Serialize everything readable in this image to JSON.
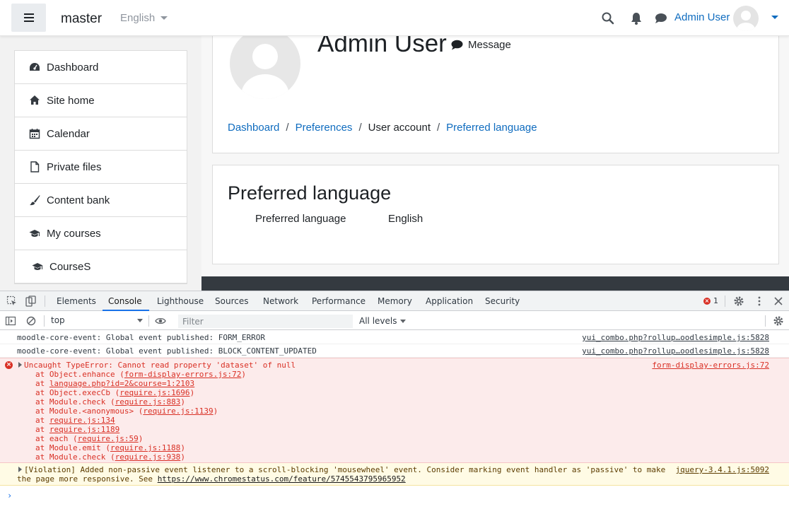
{
  "navbar": {
    "site_name": "master",
    "language": "English",
    "user_name": "Admin User"
  },
  "drawer": {
    "items": [
      {
        "label": "Dashboard",
        "icon": "dashboard-icon"
      },
      {
        "label": "Site home",
        "icon": "home-icon"
      },
      {
        "label": "Calendar",
        "icon": "calendar-icon"
      },
      {
        "label": "Private files",
        "icon": "file-icon"
      },
      {
        "label": "Content bank",
        "icon": "paintbrush-icon"
      },
      {
        "label": "My courses",
        "icon": "graduation-cap-icon"
      },
      {
        "label": "CourseS",
        "icon": "graduation-cap-icon"
      }
    ]
  },
  "profile": {
    "name": "Admin User",
    "message_label": "Message"
  },
  "breadcrumb": {
    "items": [
      "Dashboard",
      "Preferences",
      "User account",
      "Preferred language"
    ],
    "separator": "/"
  },
  "language_card": {
    "title": "Preferred language",
    "label": "Preferred language",
    "value": "English"
  },
  "devtools": {
    "tabs": [
      "Elements",
      "Console",
      "Lighthouse",
      "Sources",
      "Network",
      "Performance",
      "Memory",
      "Application",
      "Security"
    ],
    "active_tab": "Console",
    "error_count": "1",
    "context": "top",
    "filter_placeholder": "Filter",
    "levels": "All levels",
    "logs": [
      {
        "message": "moodle-core-event: Global event published: FORM_ERROR",
        "source": "yui_combo.php?rollup…oodlesimple.js:5828"
      },
      {
        "message": "moodle-core-event: Global event published: BLOCK_CONTENT_UPDATED",
        "source": "yui_combo.php?rollup…oodlesimple.js:5828"
      }
    ],
    "error": {
      "message": "Uncaught TypeError: Cannot read property 'dataset' of null",
      "source": "form-display-errors.js:72",
      "stack": [
        {
          "prefix": "at Object.enhance (",
          "link": "form-display-errors.js:72",
          "suffix": ")"
        },
        {
          "prefix": "at ",
          "link": "language.php?id=2&course=1:2103",
          "suffix": ""
        },
        {
          "prefix": "at Object.execCb (",
          "link": "require.js:1696",
          "suffix": ")"
        },
        {
          "prefix": "at Module.check (",
          "link": "require.js:883",
          "suffix": ")"
        },
        {
          "prefix": "at Module.<anonymous> (",
          "link": "require.js:1139",
          "suffix": ")"
        },
        {
          "prefix": "at ",
          "link": "require.js:134",
          "suffix": ""
        },
        {
          "prefix": "at ",
          "link": "require.js:1189",
          "suffix": ""
        },
        {
          "prefix": "at each (",
          "link": "require.js:59",
          "suffix": ")"
        },
        {
          "prefix": "at Module.emit (",
          "link": "require.js:1188",
          "suffix": ")"
        },
        {
          "prefix": "at Module.check (",
          "link": "require.js:938",
          "suffix": ")"
        }
      ]
    },
    "warning": {
      "line1": "[Violation] Added non-passive event listener to a scroll-blocking 'mousewheel' event. Consider marking event handler as 'passive' to make",
      "line2_prefix": "the page more responsive. See ",
      "line2_link": "https://www.chromestatus.com/feature/5745543795965952",
      "source": "jquery-3.4.1.js:5092"
    },
    "prompt": "›"
  },
  "colors": {
    "link": "#0f6cbf",
    "error": "#d93025",
    "devtools_accent": "#1a73e8",
    "footer": "#343a40"
  }
}
